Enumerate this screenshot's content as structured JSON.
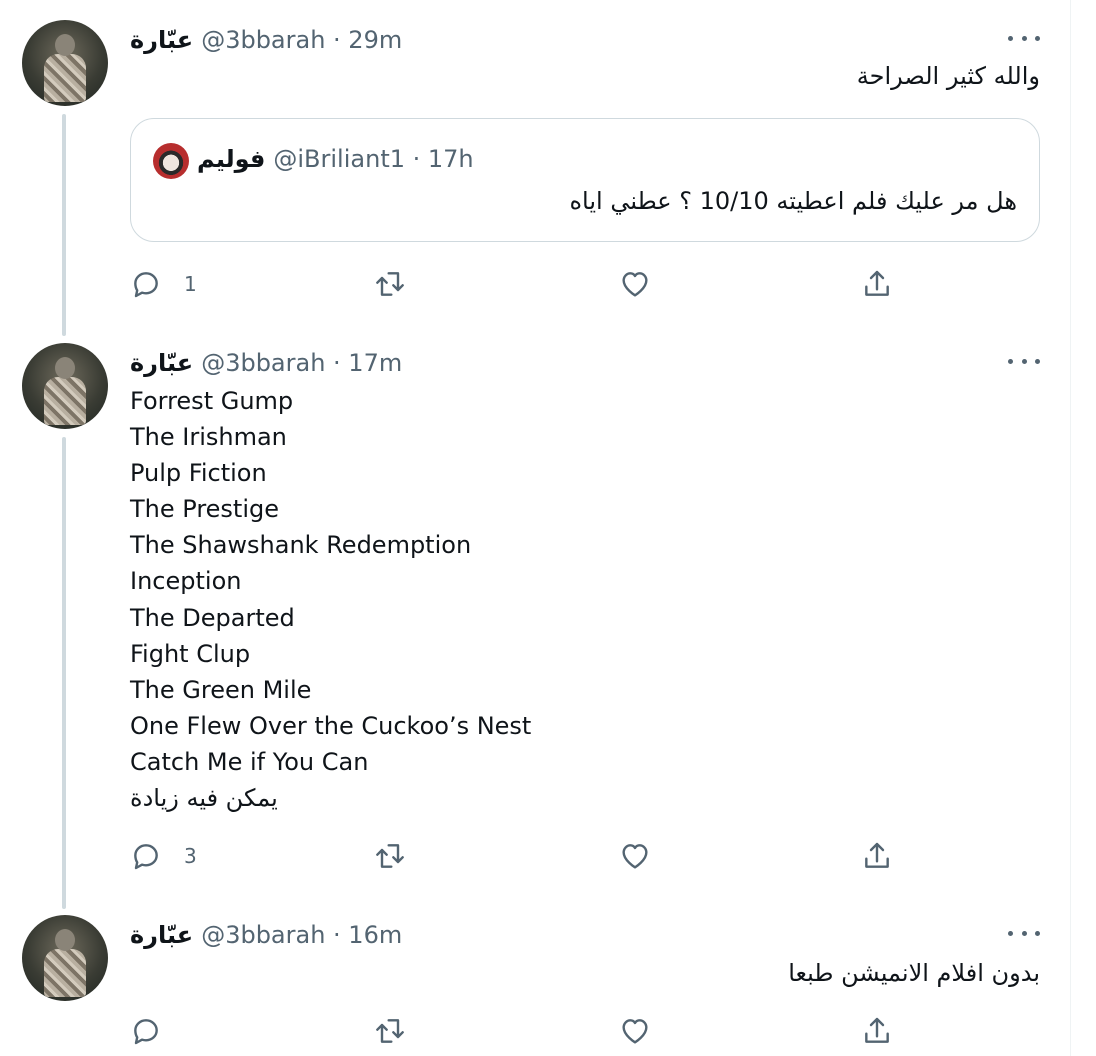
{
  "tweets": [
    {
      "name": "عبّارة",
      "meta": "@3bbarah · 29m",
      "text": "والله كثير الصراحة",
      "quote": {
        "name": "فوليم",
        "meta": "@iBriliant1 · 17h",
        "text": "هل مر عليك فلم اعطيته 10/10 ؟ عطني اياه"
      },
      "reply_count": "1"
    },
    {
      "name": "عبّارة",
      "meta": "@3bbarah · 17m",
      "lines": [
        "Forrest Gump",
        "The Irishman",
        "Pulp Fiction",
        "The Prestige",
        "The Shawshank Redemption",
        "Inception",
        "The Departed",
        "Fight Clup",
        "The Green Mile",
        "One Flew Over the Cuckoo’s Nest",
        "Catch Me if You Can",
        "يمكن فيه زيادة"
      ],
      "reply_count": "3"
    },
    {
      "name": "عبّارة",
      "meta": "@3bbarah · 16m",
      "text": "بدون افلام الانميشن طبعا",
      "reply_count": ""
    }
  ],
  "icons": {
    "reply": "reply-icon",
    "retweet": "retweet-icon",
    "like": "heart-icon",
    "share": "share-icon",
    "more": "more-icon"
  },
  "colors": {
    "text": "#0f1419",
    "secondary": "#536471",
    "thread_line": "#cfd9de",
    "border": "#cfd9de"
  }
}
